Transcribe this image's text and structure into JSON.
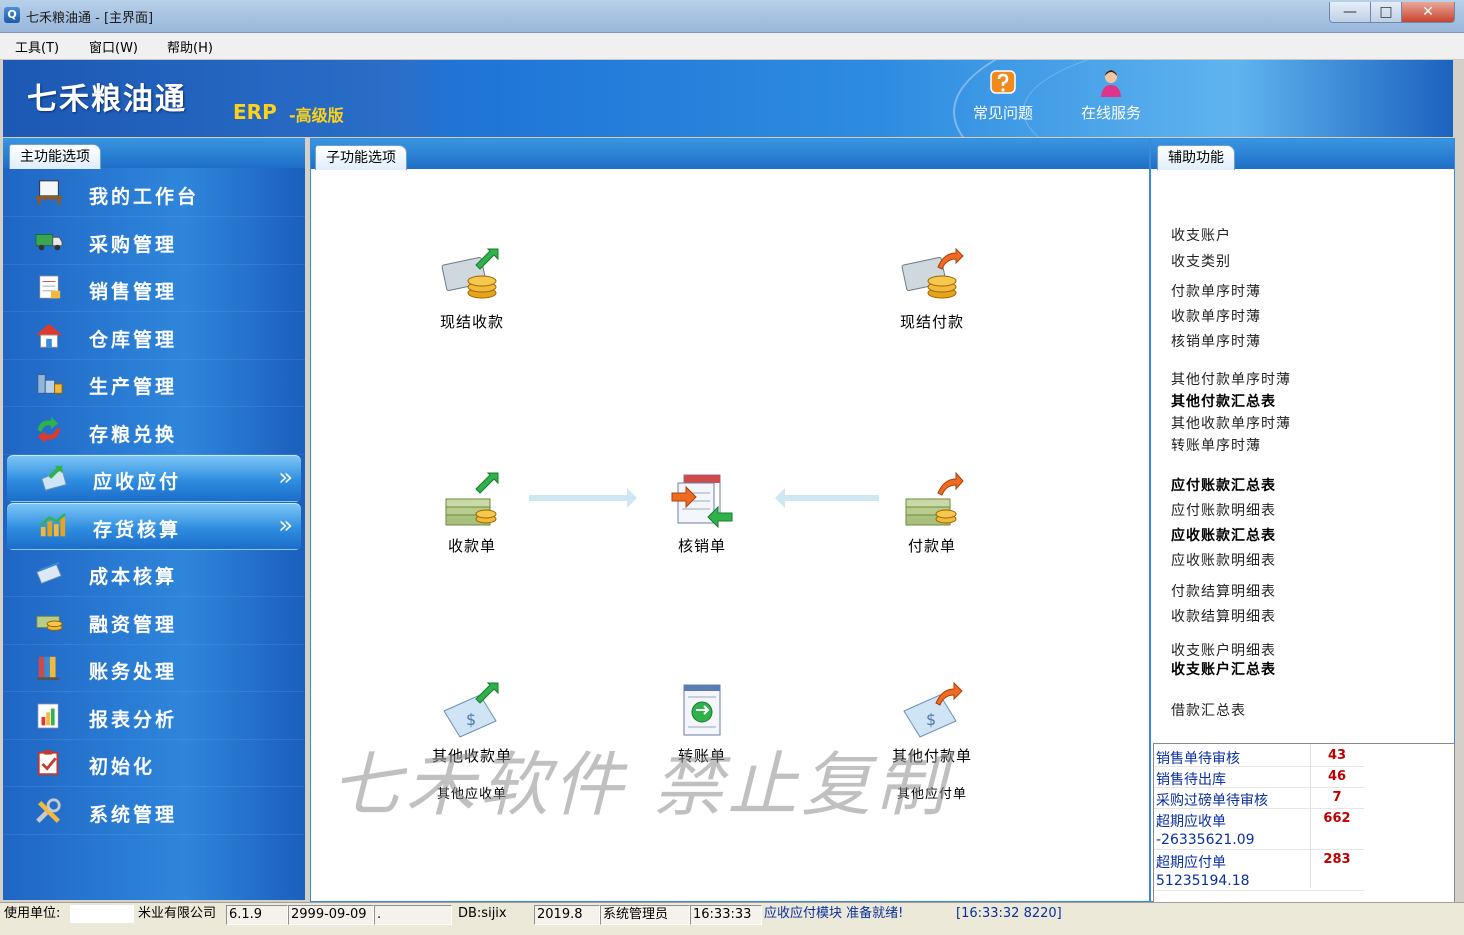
{
  "window": {
    "title": "七禾粮油通 - [主界面]",
    "min": "—",
    "max": "□",
    "close": "✕"
  },
  "menu": [
    {
      "label": "工具(T)"
    },
    {
      "label": "窗口(W)"
    },
    {
      "label": "帮助(H)"
    }
  ],
  "banner": {
    "logo": "七禾粮油通",
    "edition_erp": "ERP",
    "edition_name": "-高级版",
    "tools": [
      {
        "label": "常见问题",
        "icon": "help-icon"
      },
      {
        "label": "在线服务",
        "icon": "support-agent-icon"
      }
    ]
  },
  "left": {
    "tab": "主功能选项",
    "items": [
      {
        "label": "我的工作台",
        "icon": "workbench-icon",
        "active": false
      },
      {
        "label": "采购管理",
        "icon": "truck-icon",
        "active": false
      },
      {
        "label": "销售管理",
        "icon": "document-icon",
        "active": false
      },
      {
        "label": "仓库管理",
        "icon": "house-icon",
        "active": false
      },
      {
        "label": "生产管理",
        "icon": "factory-icon",
        "active": false
      },
      {
        "label": "存粮兑换",
        "icon": "exchange-arrows-icon",
        "active": false
      },
      {
        "label": "应收应付",
        "icon": "receivable-icon",
        "active": true,
        "chevron": "»"
      },
      {
        "label": "存货核算",
        "icon": "bar-chart-icon",
        "active": true,
        "chevron": "»"
      },
      {
        "label": "成本核算",
        "icon": "cost-icon",
        "active": false
      },
      {
        "label": "融资管理",
        "icon": "money-icon",
        "active": false
      },
      {
        "label": "账务处理",
        "icon": "ledger-icon",
        "active": false
      },
      {
        "label": "报表分析",
        "icon": "report-icon",
        "active": false
      },
      {
        "label": "初始化",
        "icon": "checklist-icon",
        "active": false
      },
      {
        "label": "系统管理",
        "icon": "tools-icon",
        "active": false
      }
    ]
  },
  "center": {
    "tab": "子功能选项",
    "functions": {
      "cash_receipt": "现结收款",
      "cash_payment": "现结付款",
      "receipt": "收款单",
      "writeoff": "核销单",
      "payment": "付款单",
      "other_receipt": "其他收款单",
      "transfer": "转账单",
      "other_payment": "其他付款单",
      "other_receivable": "其他应收单",
      "other_payable": "其他应付单"
    },
    "watermark": "七禾软件 禁止复制"
  },
  "right": {
    "tab": "辅助功能",
    "links": [
      {
        "label": "收支账户",
        "bold": false
      },
      {
        "label": "收支类别",
        "bold": false
      },
      {
        "label": "付款单序时薄",
        "bold": false
      },
      {
        "label": "收款单序时薄",
        "bold": false
      },
      {
        "label": "核销单序时薄",
        "bold": false
      },
      {
        "label": "其他付款单序时薄",
        "bold": false
      },
      {
        "label": "其他付款汇总表",
        "bold": true
      },
      {
        "label": "其他收款单序时薄",
        "bold": false
      },
      {
        "label": "转账单序时薄",
        "bold": false
      },
      {
        "label": "应付账款汇总表",
        "bold": true
      },
      {
        "label": "应付账款明细表",
        "bold": false
      },
      {
        "label": "应收账款汇总表",
        "bold": true
      },
      {
        "label": "应收账款明细表",
        "bold": false
      },
      {
        "label": "付款结算明细表",
        "bold": false
      },
      {
        "label": "收款结算明细表",
        "bold": false
      },
      {
        "label": "收支账户明细表",
        "bold": false
      },
      {
        "label": "收支账户汇总表",
        "bold": true
      },
      {
        "label": "借款汇总表",
        "bold": false
      }
    ],
    "pending": [
      {
        "label": "销售单待审核",
        "value": "43"
      },
      {
        "label": "销售待出库",
        "value": "46"
      },
      {
        "label": "采购过磅单待审核",
        "value": "7"
      },
      {
        "label": "超期应收单",
        "value": "662",
        "amount": "-26335621.09"
      },
      {
        "label": "超期应付单",
        "value": "283",
        "amount": "51235194.18"
      }
    ]
  },
  "status": {
    "unit_label": "使用单位:",
    "unit_name": "米业有限公司",
    "version": "6.1.9",
    "expiry": "2999-09-09",
    "blank": ".",
    "db": "DB:sijix",
    "period": "2019.8",
    "user": "系统管理员",
    "time": "16:33:33",
    "module_msg": "应收应付模块 准备就绪!",
    "log": "[16:33:32 8220]"
  },
  "colors": {
    "accent": "#1f6fc7",
    "pending_value": "#c00000",
    "link_blue": "#0a2fa0"
  }
}
